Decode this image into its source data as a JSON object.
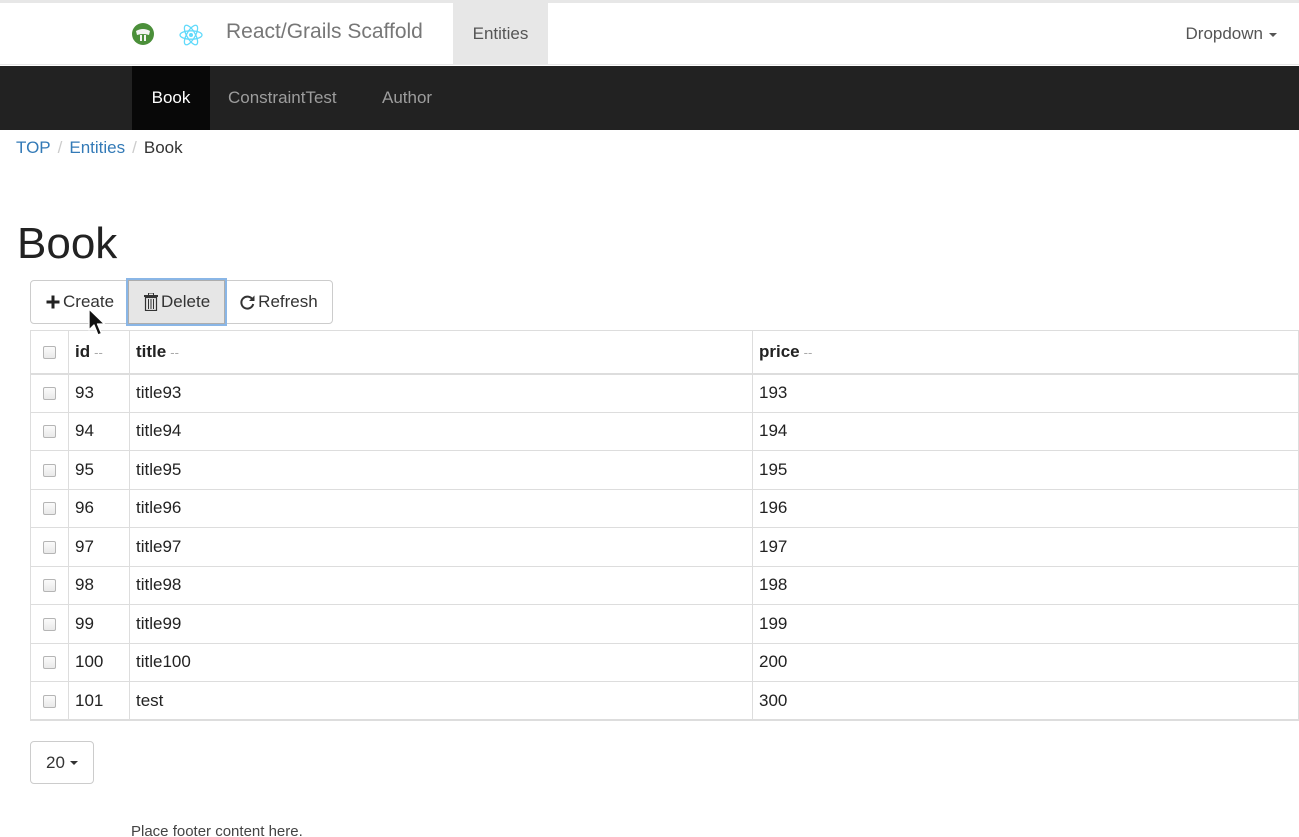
{
  "navbar": {
    "brand": "React/Grails Scaffold",
    "entities": "Entities",
    "dropdown": "Dropdown",
    "grails_icon": "grails-logo-icon",
    "react_icon": "react-logo-icon"
  },
  "subnav": {
    "tabs": [
      {
        "label": "Book",
        "active": true
      },
      {
        "label": "ConstraintTest",
        "active": false
      },
      {
        "label": "Author",
        "active": false
      }
    ]
  },
  "breadcrumb": {
    "items": [
      "TOP",
      "Entities",
      "Book"
    ]
  },
  "page": {
    "title": "Book"
  },
  "toolbar": {
    "create_label": "Create",
    "delete_label": "Delete",
    "refresh_label": "Refresh",
    "create_icon": "plus-icon",
    "delete_icon": "trash-icon",
    "refresh_icon": "refresh-icon"
  },
  "table": {
    "columns": [
      "id",
      "title",
      "price"
    ],
    "sort_indicator": "--",
    "rows": [
      {
        "id": "93",
        "title": "title93",
        "price": "193"
      },
      {
        "id": "94",
        "title": "title94",
        "price": "194"
      },
      {
        "id": "95",
        "title": "title95",
        "price": "195"
      },
      {
        "id": "96",
        "title": "title96",
        "price": "196"
      },
      {
        "id": "97",
        "title": "title97",
        "price": "197"
      },
      {
        "id": "98",
        "title": "title98",
        "price": "198"
      },
      {
        "id": "99",
        "title": "title99",
        "price": "199"
      },
      {
        "id": "100",
        "title": "title100",
        "price": "200"
      },
      {
        "id": "101",
        "title": "test",
        "price": "300"
      }
    ]
  },
  "pager": {
    "page_size": "20"
  },
  "footer": {
    "text": "Place footer content here."
  },
  "colors": {
    "dark_nav": "#222222",
    "active_tab": "#080808",
    "link": "#337ab7",
    "focus_ring": "#8ab6e6"
  }
}
